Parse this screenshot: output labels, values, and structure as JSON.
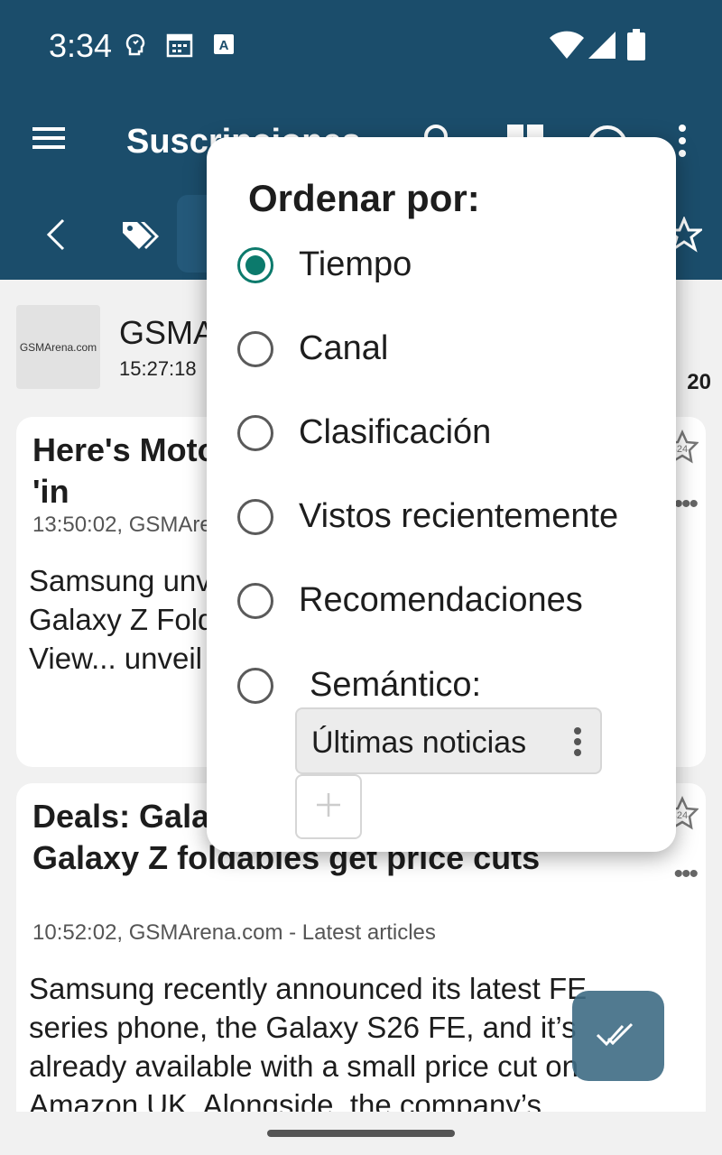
{
  "status_bar": {
    "time": "3:34"
  },
  "app_bar": {
    "title": "Suscripciones"
  },
  "feed": {
    "name": "GSMArena.com - Latest articles",
    "logo_text": "GSMArena.com",
    "time": "15:27:18",
    "count": "20"
  },
  "articles": [
    {
      "title": "Here's Motorola's first foldable arriving 'in",
      "meta": "13:50:02, GSMArena.com - Latest articles",
      "body": "Samsung unveiled its Galaxy smartphones Galaxy Z Fold8. In August Huawei Pura X View... unveil its wide"
    },
    {
      "title": "Deals: Galaxy S26 FE and the latest Galaxy Z foldables get price cuts",
      "meta": "10:52:02, GSMArena.com - Latest articles",
      "body": "Samsung recently announced its latest FE series phone, the Galaxy S26 FE, and it’s already available with a small price cut on Amazon UK. Alongside, the company’s"
    }
  ],
  "dialog": {
    "title": "Ordenar por:",
    "options": [
      {
        "label": "Tiempo",
        "selected": true
      },
      {
        "label": "Canal",
        "selected": false
      },
      {
        "label": "Clasificación",
        "selected": false
      },
      {
        "label": "Vistos recientemente",
        "selected": false
      },
      {
        "label": "Recomendaciones",
        "selected": false
      },
      {
        "label": "Semántico:",
        "selected": false
      }
    ],
    "semantic_value": "Últimas noticias",
    "add_symbol": "+"
  },
  "colors": {
    "primary": "#1b4d6b",
    "accent": "#0c7a6c",
    "fab": "#3f6c85"
  }
}
